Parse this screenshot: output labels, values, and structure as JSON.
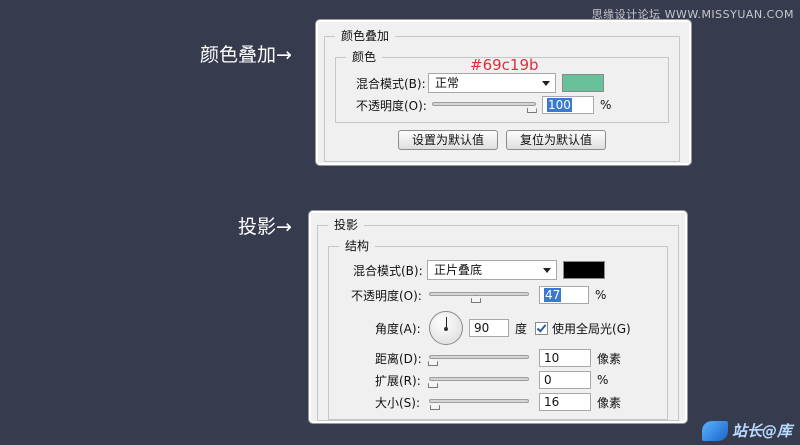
{
  "watermark_top": "思缘设计论坛 WWW.MISSYUAN.COM",
  "watermark_bottom": "站长@库",
  "color_overlay": {
    "side_label": "颜色叠加→",
    "hex_annotation": "#69c19b",
    "group_title": "颜色叠加",
    "subgroup_title": "颜色",
    "blend_mode_label": "混合模式(B):",
    "blend_mode_value": "正常",
    "swatch_color": "#69c19b",
    "opacity_label": "不透明度(O):",
    "opacity_value": "100",
    "opacity_fraction": 1.0,
    "opacity_unit": "%",
    "set_default_label": "设置为默认值",
    "reset_default_label": "复位为默认值"
  },
  "drop_shadow": {
    "side_label": "投影→",
    "group_title": "投影",
    "subgroup_title": "结构",
    "blend_mode_label": "混合模式(B):",
    "blend_mode_value": "正片叠底",
    "swatch_color": "#000000",
    "opacity_label": "不透明度(O):",
    "opacity_value": "47",
    "opacity_fraction": 0.47,
    "opacity_unit": "%",
    "angle_label": "角度(A):",
    "angle_value": "90",
    "angle_unit": "度",
    "global_light_label": "使用全局光(G)",
    "global_light_checked": true,
    "distance_label": "距离(D):",
    "distance_value": "10",
    "distance_fraction": 0.04,
    "distance_unit": "像素",
    "spread_label": "扩展(R):",
    "spread_value": "0",
    "spread_fraction": 0.0,
    "spread_unit": "%",
    "size_label": "大小(S):",
    "size_value": "16",
    "size_fraction": 0.06,
    "size_unit": "像素"
  }
}
